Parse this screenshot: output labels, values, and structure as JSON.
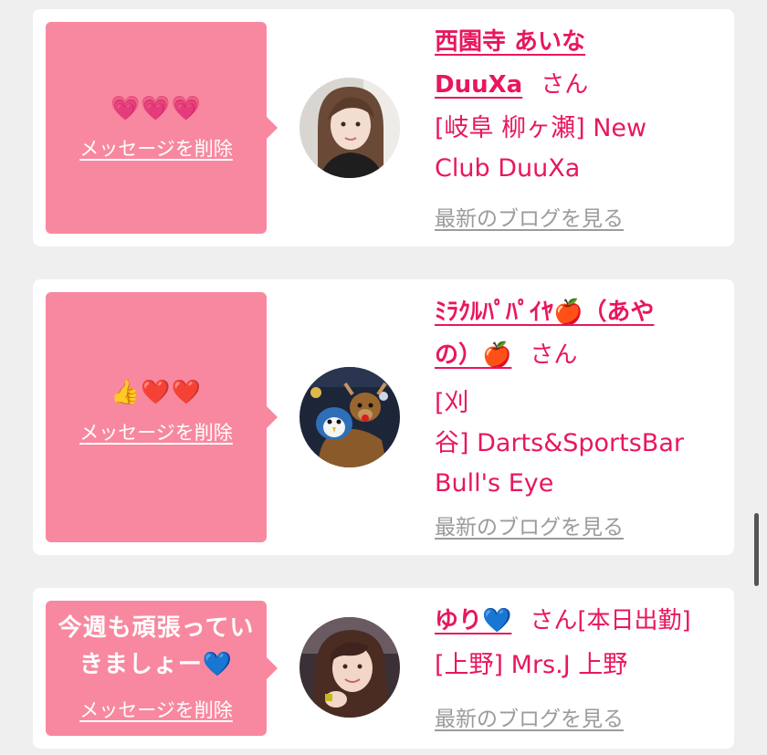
{
  "cards": [
    {
      "message": "💗💗💗",
      "delete_label": "メッセージを削除",
      "name_line1": "西園寺 あいな",
      "name_line2": "DuuXa",
      "honorific": "さん",
      "shop_line1": "[岐阜 柳ヶ瀬] New",
      "shop_line2": "Club DuuXa",
      "blog_label": "最新のブログを見る",
      "avatar": "woman-portrait-1"
    },
    {
      "message": "👍❤️❤️",
      "delete_label": "メッセージを削除",
      "name_line1": "ﾐﾗｸﾙﾊﾟﾊﾟｲﾔ🍎（あや",
      "name_line2": "の）🍎",
      "honorific": "さん",
      "shop_line1": "[刈",
      "shop_line2": "谷] Darts&SportsBar",
      "shop_line3": "Bull's Eye",
      "blog_label": "最新のブログを見る",
      "avatar": "plush-toys-photo"
    },
    {
      "message": "今週も頑張ってい\nきましょー💙",
      "delete_label": "メッセージを削除",
      "name_line1": "ゆり💙",
      "honorific": "さん[本日出勤]",
      "shop_line1": "[上野] Mrs.J 上野",
      "blog_label": "最新のブログを見る",
      "avatar": "woman-portrait-2"
    }
  ],
  "colors": {
    "accent": "#e8175d",
    "bubble": "#f8889f",
    "background": "#efefef",
    "muted_link": "#9b9b9b"
  }
}
